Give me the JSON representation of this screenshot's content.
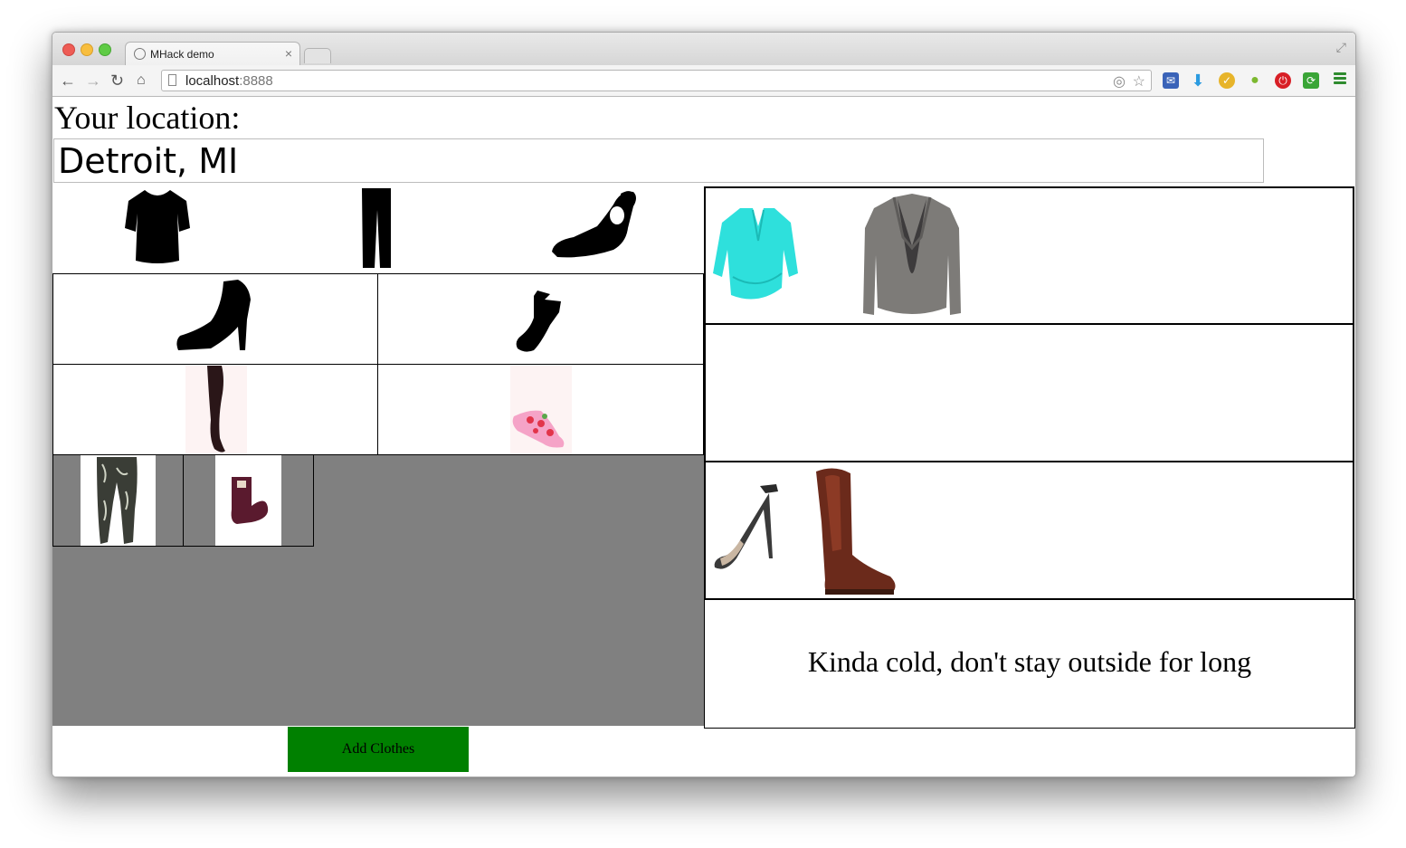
{
  "browser": {
    "tab_title": "MHack demo",
    "tab_close": "×",
    "url_host": "localhost",
    "url_port": ":8888"
  },
  "page": {
    "location_label": "Your location:",
    "location_value": "Detroit, MI",
    "weather_message": "Kinda cold, don't stay outside for long",
    "add_button_label": "Add Clothes"
  },
  "icons": {
    "categories": [
      "top-icon",
      "pants-icon",
      "sandal-icon",
      "heel-boot-icon",
      "sock-icon"
    ],
    "wardrobe_items": [
      "tights-item",
      "strawberry-socks-item",
      "lace-leggings-item",
      "maroon-socks-item"
    ],
    "outfit_tops": [
      "turquoise-blouse-item",
      "gray-blazer-item"
    ],
    "outfit_shoes": [
      "ankle-strap-heels-item",
      "brown-riding-boots-item"
    ]
  },
  "colors": {
    "wardrobe_background": "#808080",
    "add_button": "#008000"
  }
}
